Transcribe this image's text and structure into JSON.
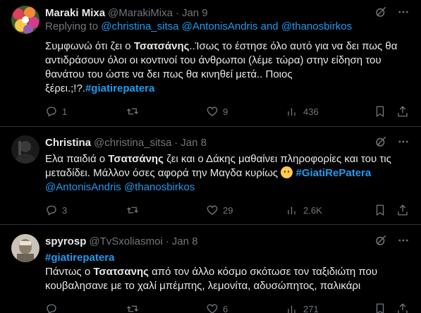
{
  "tweets": [
    {
      "name": "Maraki Mixa",
      "handle": "@MarakiMixa",
      "sep": "·",
      "date": "Jan 9",
      "replying_prefix": "Replying to ",
      "replying_user1": "@christina_sitsa",
      "replying_user2": "@AntonisAndris",
      "replying_and": " and ",
      "replying_user3": "@thanosbirkos",
      "text_l1a": "Συμφωνώ ότι ζει ο ",
      "text_l1b": "Τσατσάνης",
      "text_l1c": "..Ίσως το έστησε όλο αυτό για να δει πως θα",
      "text_l2": "αντιδράσουν όλοι οι κοντινοί του άνθρωποι (λέμε τώρα) στην είδηση του",
      "text_l3": "θανάτου του ώστε να δει πως θα κινηθεί μετά.. Ποιος",
      "text_l4a": "ξέρει.;!?.",
      "text_l4b": "#giatirepatera",
      "replies": "1",
      "retweets": "",
      "likes": "9",
      "views": "436"
    },
    {
      "name": "Christina",
      "handle": "@christina_sitsa",
      "sep": "·",
      "date": "Jan 8",
      "text_l1a": "Ελα παιδιά ο ",
      "text_l1b": "Τσατσάνης",
      "text_l1c": " ζει και ο Δάκης μαθαίνει πληροφορίες και του τις",
      "text_l2a": "μεταδίδει. Μάλλον όσες αφορά την Μαγδα κυρίως ",
      "text_l2b": "#GiatiRePatera",
      "text_l3a": "@AntonisAndris",
      "text_l3b": "@thanosbirkos",
      "replies": "3",
      "retweets": "",
      "likes": "29",
      "views": "2.6K"
    },
    {
      "name": "spyrosp",
      "handle": "@TvSxoliasmoi",
      "sep": "·",
      "date": "Jan 8",
      "text_l1": "#giatirepatera",
      "text_l2a": "Πάντως ο ",
      "text_l2b": "Τσατσανης",
      "text_l2c": " από τον άλλο κόσμο σκότωσε τον ταξιδιώτη που",
      "text_l3": "κουβαλησανε με το χαλί μπέμπης, λεμονίτα, αδυσώπητος, παλικάρι",
      "replies": "",
      "retweets": "",
      "likes": "6",
      "views": "271"
    }
  ],
  "icons": [
    "reply-icon",
    "retweet-icon",
    "like-icon",
    "views-icon",
    "bookmark-icon",
    "share-icon",
    "grok-icon",
    "more-icon"
  ],
  "colors": {
    "background": "#000000",
    "text": "#e7e9ea",
    "muted": "#71767b",
    "link": "#1d9bf0",
    "border": "#2f3336"
  }
}
